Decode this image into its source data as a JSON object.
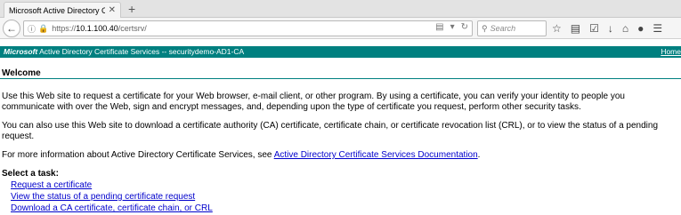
{
  "browser": {
    "tab_title": "Microsoft Active Directory Cert...",
    "tab_close": "✕",
    "new_tab": "+",
    "url_prefix": "https://",
    "url_host": "10.1.100.40",
    "url_path": "/certsrv/",
    "search_placeholder": "Search"
  },
  "header": {
    "brand": "Microsoft",
    "title": " Active Directory Certificate Services  --  securitydemo-AD1-CA",
    "home_link": "Home"
  },
  "page": {
    "welcome": "Welcome",
    "p1": "Use this Web site to request a certificate for your Web browser, e-mail client, or other program. By using a certificate, you can verify your identity to people you communicate with over the Web, sign and encrypt messages, and, depending upon the type of certificate you request, perform other security tasks.",
    "p2": "You can also use this Web site to download a certificate authority (CA) certificate, certificate chain, or certificate revocation list (CRL), or to view the status of a pending request.",
    "p3_before": "For more information about Active Directory Certificate Services, see ",
    "p3_link": "Active Directory Certificate Services Documentation",
    "p3_after": ".",
    "task_heading": "Select a task:",
    "tasks": [
      "Request a certificate",
      "View the status of a pending certificate request",
      "Download a CA certificate, certificate chain, or CRL"
    ]
  },
  "colors": {
    "header_bg": "#008080",
    "link": "#0000cc"
  }
}
